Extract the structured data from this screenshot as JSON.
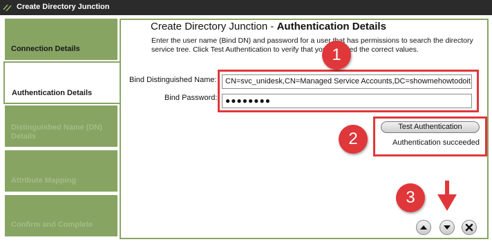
{
  "window": {
    "title": "Create Directory Junction"
  },
  "steps": [
    {
      "label": "Connection Details",
      "state": "completed"
    },
    {
      "label": "Authentication Details",
      "state": "active"
    },
    {
      "label": "Distinguished Name (DN) Details",
      "state": "upcoming"
    },
    {
      "label": "Attribute Mapping",
      "state": "upcoming"
    },
    {
      "label": "Confirm and Complete",
      "state": "upcoming"
    }
  ],
  "main": {
    "heading_prefix": "Create Directory Junction - ",
    "heading_bold": "Authentication Details",
    "description": "Enter the user name (Bind DN) and password for a user that has permissions to search the directory service tree.  Click Test Authentication to verify that you specified the correct values.",
    "bind_dn_label": "Bind Distinguished Name:",
    "bind_dn_value": "CN=svc_unidesk,CN=Managed Service Accounts,DC=showmehowtodoit,",
    "bind_password_label": "Bind Password:",
    "bind_password_value": "●●●●●●●●",
    "test_button_label": "Test Authentication",
    "status_text": "Authentication succeeded"
  },
  "callouts": [
    "1",
    "2",
    "3"
  ],
  "nav_icons": [
    "up-arrow-icon",
    "down-arrow-icon",
    "close-icon"
  ],
  "colors": {
    "step_green": "#87a463",
    "callout_red": "#e0373a",
    "titlebar": "#2b2b2b"
  }
}
